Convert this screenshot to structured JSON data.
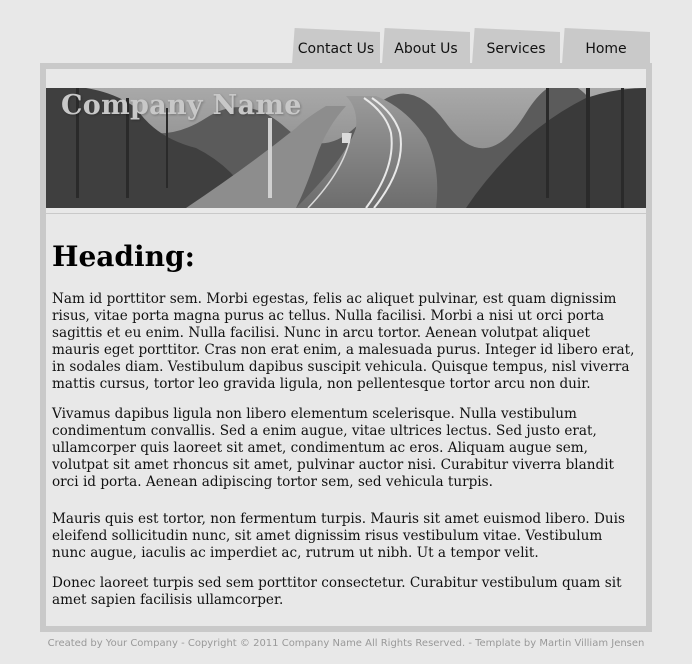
{
  "nav": {
    "items": [
      {
        "label": "Contact Us"
      },
      {
        "label": "About Us"
      },
      {
        "label": "Services"
      },
      {
        "label": "Home"
      }
    ]
  },
  "header": {
    "company_name": "Company Name"
  },
  "main": {
    "heading": "Heading:",
    "paragraphs": [
      "Nam id porttitor sem. Morbi egestas, felis ac aliquet pulvinar, est quam dignissim risus, vitae porta magna purus ac tellus. Nulla facilisi. Morbi a nisi ut orci porta sagittis et eu enim. Nulla facilisi. Nunc in arcu tortor. Aenean volutpat aliquet mauris eget porttitor. Cras non erat enim, a malesuada purus. Integer id libero erat, in sodales diam. Vestibulum dapibus suscipit vehicula. Quisque tempus, nisl viverra mattis cursus, tortor leo gravida ligula, non pellentesque tortor arcu non duir.",
      "Vivamus dapibus ligula non libero elementum scelerisque. Nulla vestibulum condimentum convallis. Sed a enim augue, vitae ultrices lectus. Sed justo erat, ullamcorper quis laoreet sit amet, condimentum ac eros. Aliquam augue sem, volutpat sit amet rhoncus sit amet, pulvinar auctor nisi. Curabitur viverra blandit orci id porta. Aenean adipiscing tortor sem, sed vehicula turpis.",
      "Mauris quis est tortor, non fermentum turpis. Mauris sit amet euismod libero. Duis eleifend sollicitudin nunc, sit amet dignissim risus vestibulum vitae. Vestibulum nunc augue, iaculis ac imperdiet ac, rutrum ut nibh. Ut a tempor velit.",
      "Donec laoreet turpis sed sem porttitor consectetur. Curabitur vestibulum quam sit amet sapien facilisis ullamcorper."
    ]
  },
  "footer": {
    "text": "Created by Your Company - Copyright © 2011 Company Name All Rights Reserved. - Template by Martin Villiam Jensen"
  },
  "colors": {
    "background": "#e8e8e8",
    "frame": "#c9c9c9",
    "tab": "#c9c9c9",
    "footer_text": "#999999",
    "company_name": "#c8c8c8"
  },
  "icons": {
    "banner": "road-photo"
  }
}
